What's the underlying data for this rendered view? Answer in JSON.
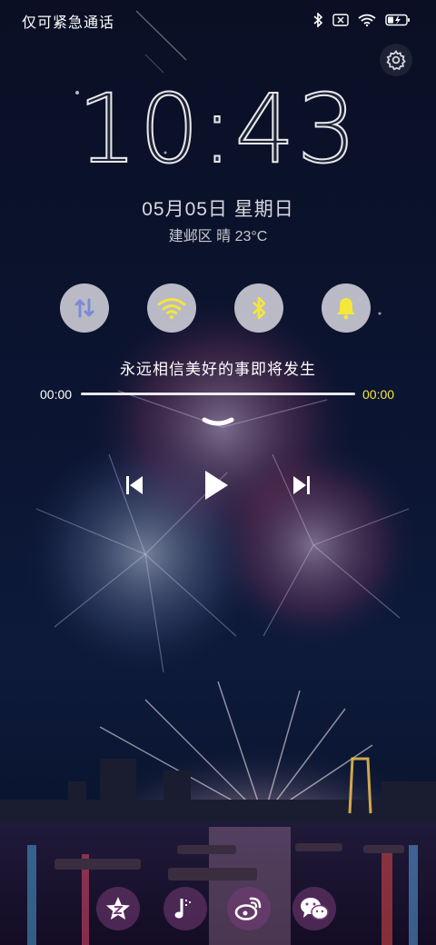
{
  "status_bar": {
    "carrier_text": "仅可紧急通话",
    "icons": [
      "bluetooth-icon",
      "no-sim-icon",
      "wifi-icon",
      "battery-charging-icon"
    ]
  },
  "settings": {
    "icon": "gear-icon"
  },
  "lock": {
    "time": "10:43",
    "date": "05月05日  星期日",
    "weather": "建邺区 晴 23°C"
  },
  "toggles": [
    {
      "icon": "sync-icon"
    },
    {
      "icon": "wifi-icon"
    },
    {
      "icon": "bluetooth-icon"
    },
    {
      "icon": "bell-icon"
    }
  ],
  "music": {
    "title": "永远相信美好的事即将发生",
    "elapsed": "00:00",
    "duration": "00:00",
    "progress": 0,
    "accent_color": "#f5e63c"
  },
  "controls": {
    "prev": "skip-previous-icon",
    "play": "play-icon",
    "next": "skip-next-icon"
  },
  "apps": [
    {
      "icon": "qzone-star-icon"
    },
    {
      "icon": "music-note-icon"
    },
    {
      "icon": "weibo-icon"
    },
    {
      "icon": "wechat-icon"
    }
  ]
}
